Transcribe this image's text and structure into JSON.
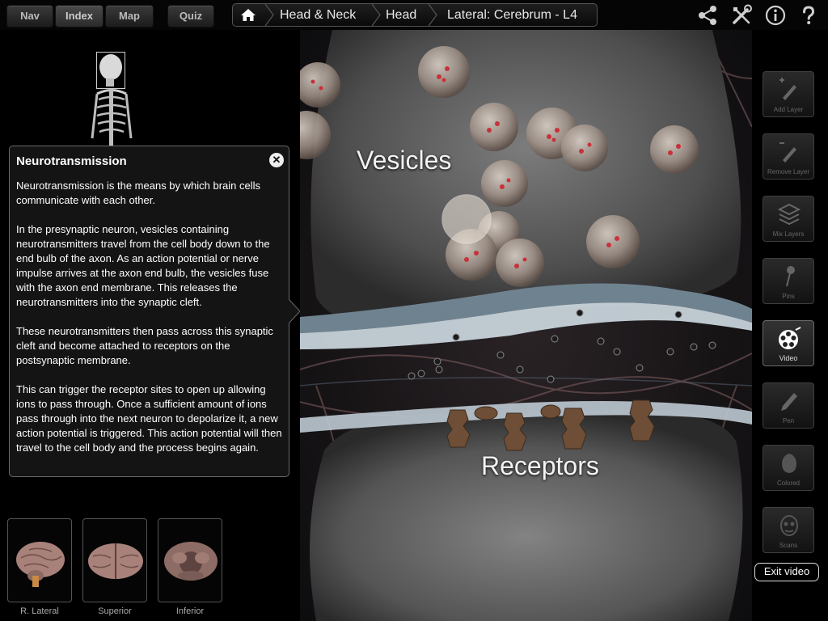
{
  "nav": {
    "tabs": [
      {
        "label": "Nav"
      },
      {
        "label": "Index"
      },
      {
        "label": "Map"
      }
    ],
    "quiz_label": "Quiz"
  },
  "breadcrumb": {
    "items": [
      "Head & Neck",
      "Head",
      "Lateral: Cerebrum - L4"
    ]
  },
  "popup": {
    "title": "Neurotransmission",
    "paragraphs": [
      "Neurotransmission is the means by which brain cells communicate with each other.",
      "In the presynaptic neuron, vesicles containing neurotransmitters travel from the cell body down to the end bulb of the axon.  As an action potential or nerve impulse arrives at the axon end bulb, the vesicles fuse with the axon end membrane.  This releases the neurotransmitters into the synaptic cleft.",
      "These neurotransmitters then pass across this synaptic cleft and become attached to receptors on the postsynaptic membrane.",
      "This can trigger the receptor sites to open up allowing ions to pass through.  Once a sufficient amount of ions pass through into the next neuron to depolarize it, a new action potential is triggered.  This action potential will then travel to the cell body and the process begins again."
    ]
  },
  "thumbnails": [
    {
      "label": "R. Lateral"
    },
    {
      "label": "Superior"
    },
    {
      "label": "Inferior"
    }
  ],
  "video": {
    "label_top": "Vesicles",
    "label_bottom": "Receptors"
  },
  "tools": [
    {
      "label": "Add Layer",
      "icon": "add-layer-icon"
    },
    {
      "label": "Remove Layer",
      "icon": "remove-layer-icon"
    },
    {
      "label": "Mix Layers",
      "icon": "mix-layers-icon"
    },
    {
      "label": "Pins",
      "icon": "pin-icon"
    },
    {
      "label": "Video",
      "icon": "film-reel-icon"
    },
    {
      "label": "Pen",
      "icon": "pen-icon"
    },
    {
      "label": "Colored",
      "icon": "colored-icon"
    },
    {
      "label": "Scans",
      "icon": "scans-icon"
    }
  ],
  "exit_video_label": "Exit video",
  "colors": {
    "accent": "#ffffff",
    "panel_bg": "#141414",
    "vesicle_dot": "#c8323a"
  }
}
